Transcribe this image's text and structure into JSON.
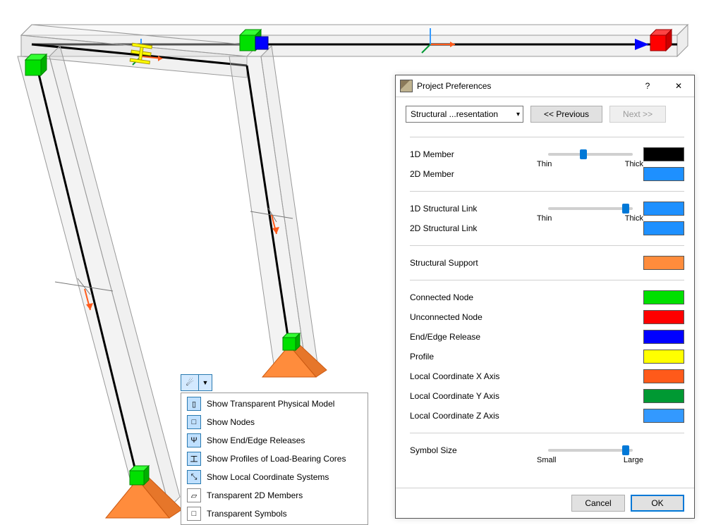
{
  "dialog": {
    "title": "Project Preferences",
    "combo": "Structural ...resentation",
    "prev": "<< Previous",
    "next": "Next >>",
    "rows": {
      "m1d": "1D Member",
      "m2d": "2D Member",
      "sl1": "1D Structural Link",
      "sl2": "2D Structural Link",
      "sup": "Structural Support",
      "cn": "Connected Node",
      "un": "Unconnected Node",
      "rel": "End/Edge Release",
      "prof": "Profile",
      "lx": "Local Coordinate X Axis",
      "ly": "Local Coordinate Y Axis",
      "lz": "Local Coordinate Z Axis",
      "sym": "Symbol Size"
    },
    "sliderLabels": {
      "thin": "Thin",
      "thick": "Thick",
      "small": "Small",
      "large": "Large"
    },
    "colors": {
      "m1d": "#000000",
      "m2d": "#1e90ff",
      "sl1": "#1e90ff",
      "sl2": "#1e90ff",
      "sup": "#ff8c3c",
      "cn": "#00e000",
      "un": "#ff0000",
      "rel": "#0000ff",
      "prof": "#ffff00",
      "lx": "#ff5a1a",
      "ly": "#009933",
      "lz": "#3399ff"
    },
    "cancel": "Cancel",
    "ok": "OK"
  },
  "menu": {
    "items": [
      {
        "icon": "▯",
        "sel": true,
        "label": "Show Transparent Physical Model"
      },
      {
        "icon": "□",
        "sel": true,
        "label": "Show Nodes"
      },
      {
        "icon": "Ψ",
        "sel": true,
        "label": "Show End/Edge Releases"
      },
      {
        "icon": "工",
        "sel": true,
        "label": "Show Profiles of Load-Bearing Cores"
      },
      {
        "icon": "⤡",
        "sel": true,
        "label": "Show Local Coordinate Systems"
      },
      {
        "icon": "▱",
        "sel": false,
        "label": "Transparent 2D Members"
      },
      {
        "icon": "□",
        "sel": false,
        "label": "Transparent Symbols"
      }
    ]
  },
  "chart_data": {
    "type": "other",
    "description": "3D structural analytical model viewport showing transparent physical members (columns and beams), green connected nodes, blue end-release node, red unconnected node, orange pyramidal supports, local coordinate axis arrows, and I-section profile markers."
  }
}
